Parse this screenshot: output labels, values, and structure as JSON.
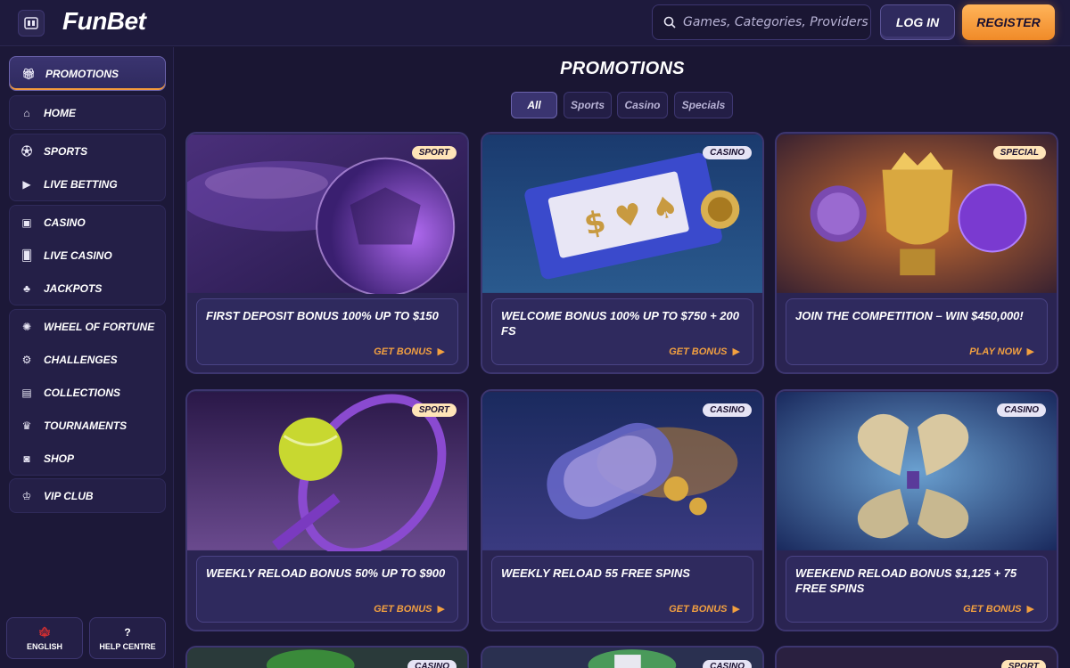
{
  "header": {
    "logo": "FunBet",
    "search_placeholder": "Games, Categories, Providers",
    "login": "LOG IN",
    "register": "REGISTER"
  },
  "sidebar": {
    "promotions": "PROMOTIONS",
    "home": "HOME",
    "sports": "SPORTS",
    "live_betting": "LIVE BETTING",
    "casino": "CASINO",
    "live_casino": "LIVE CASINO",
    "jackpots": "JACKPOTS",
    "wheel_of_fortune": "WHEEL OF FORTUNE",
    "challenges": "CHALLENGES",
    "collections": "COLLECTIONS",
    "tournaments": "TOURNAMENTS",
    "shop": "SHOP",
    "vip_club": "VIP CLUB",
    "english": "ENGLISH",
    "help_centre": "HELP CENTRE"
  },
  "main": {
    "title": "PROMOTIONS",
    "filters": [
      "All",
      "Sports",
      "Casino",
      "Specials"
    ],
    "cards": [
      {
        "badge": "SPORT",
        "title": "FIRST DEPOSIT BONUS 100% UP TO $150",
        "cta": "GET BONUS"
      },
      {
        "badge": "CASINO",
        "title": "WELCOME BONUS 100% UP TO $750 + 200 FS",
        "cta": "GET BONUS"
      },
      {
        "badge": "SPECIAL",
        "title": "JOIN THE COMPETITION – WIN $450,000!",
        "cta": "PLAY NOW"
      },
      {
        "badge": "SPORT",
        "title": "WEEKLY RELOAD BONUS 50% UP TO $900",
        "cta": "GET BONUS"
      },
      {
        "badge": "CASINO",
        "title": "WEEKLY RELOAD 55 FREE SPINS",
        "cta": "GET BONUS"
      },
      {
        "badge": "CASINO",
        "title": "WEEKEND RELOAD BONUS $1,125 + 75 FREE SPINS",
        "cta": "GET BONUS"
      },
      {
        "badge": "CASINO"
      },
      {
        "badge": "CASINO"
      },
      {
        "badge": "SPORT"
      }
    ]
  }
}
